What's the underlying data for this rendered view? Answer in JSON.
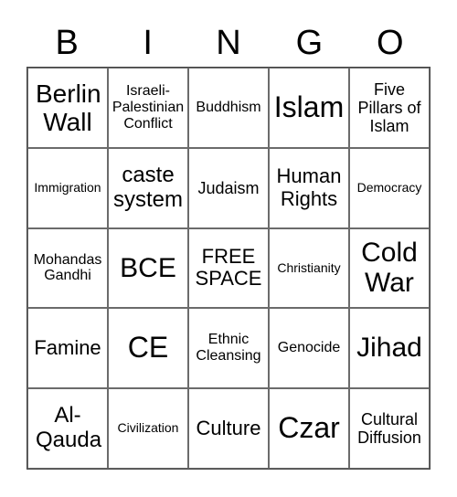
{
  "header": {
    "letters": [
      "B",
      "I",
      "N",
      "G",
      "O"
    ]
  },
  "board": {
    "rows": [
      [
        "Berlin Wall",
        "Israeli-Palestinian Conflict",
        "Buddhism",
        "Islam",
        "Five Pillars of Islam"
      ],
      [
        "Immigration",
        "caste system",
        "Judaism",
        "Human Rights",
        "Democracy"
      ],
      [
        "Mohandas Gandhi",
        "BCE",
        "FREE SPACE",
        "Christianity",
        "Cold War"
      ],
      [
        "Famine",
        "CE",
        "Ethnic Cleansing",
        "Genocide",
        "Jihad"
      ],
      [
        "Al-Qauda",
        "Civilization",
        "Culture",
        "Czar",
        "Cultural Diffusion"
      ]
    ]
  },
  "cells_display": {
    "r0": [
      "Berlin\nWall",
      "Israeli-\nPalestinian\nConflict",
      "Buddhism",
      "Islam",
      "Five\nPillars of\nIslam"
    ],
    "r1": [
      "Immigration",
      "caste\nsystem",
      "Judaism",
      "Human\nRights",
      "Democracy"
    ],
    "r2": [
      "Mohandas\nGandhi",
      "BCE",
      "FREE\nSPACE",
      "Christianity",
      "Cold\nWar"
    ],
    "r3": [
      "Famine",
      "CE",
      "Ethnic\nCleansing",
      "Genocide",
      "Jihad"
    ],
    "r4": [
      "Al-\nQauda",
      "Civilization",
      "Culture",
      "Czar",
      "Cultural\nDiffusion"
    ]
  }
}
